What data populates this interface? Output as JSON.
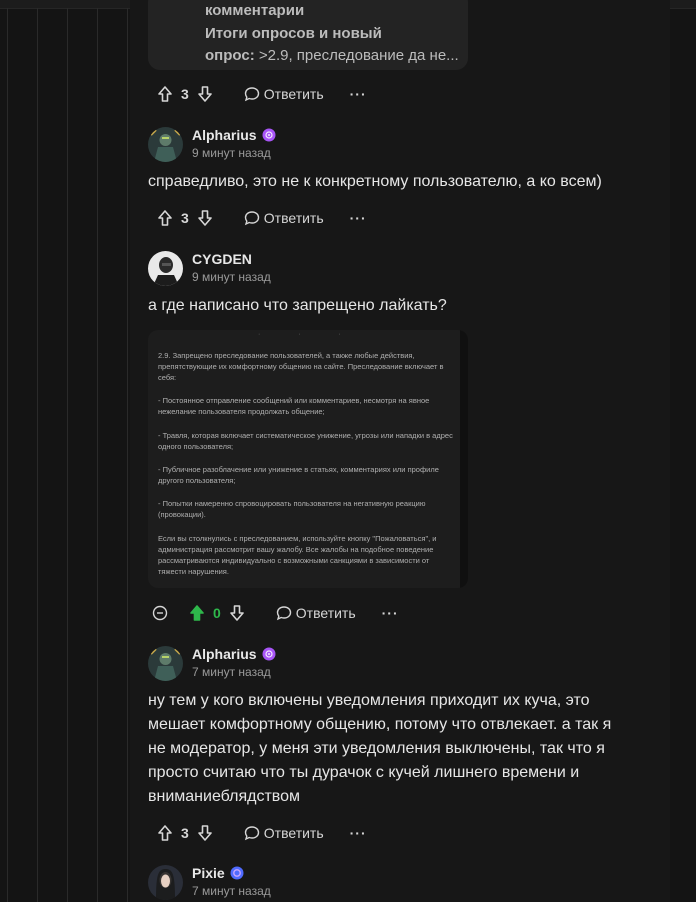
{
  "quote_card": {
    "line1": "комментарии",
    "line2": "Итоги опросов и новый",
    "line3_bold": "опрос:",
    "line3_rest": " >2.9, преследование да не..."
  },
  "comments": [
    {
      "votes": "3",
      "reply_label": "Ответить",
      "more_label": "···"
    },
    {
      "author": "Alpharius",
      "time": "9 минут назад",
      "text": "справедливо, это не к конкретному пользователю, а ко всем)",
      "votes": "3",
      "reply_label": "Ответить",
      "more_label": "···"
    },
    {
      "author": "CYGDEN",
      "time": "9 минут назад",
      "text": "а где написано что запрещено лайкать?",
      "votes": "0",
      "reply_label": "Ответить",
      "more_label": "···"
    },
    {
      "author": "Alpharius",
      "time": "7 минут назад",
      "text_lines": [
        "ну тем у кого включены уведомления приходит их куча, это",
        "мешает комфортному общению, потому что отвлекает. а так я",
        "не модератор, у меня эти уведомления выключены, так что я",
        "просто считаю что ты дурачок с кучей лишнего времени и",
        "вниманиеблядством"
      ],
      "votes": "3",
      "reply_label": "Ответить",
      "more_label": "···"
    },
    {
      "author": "Pixie",
      "time": "7 минут назад"
    }
  ],
  "rules_image": {
    "paragraphs": [
      "2.9. Запрещено преследование пользователей, а также любые действия, препятствующие их комфортному общению на сайте. Преследование включает в себя:",
      "- Постоянное отправление сообщений или комментариев, несмотря на явное нежелание пользователя продолжать общение;",
      "- Травля, которая включает систематическое унижение, угрозы или нападки в адрес одного пользователя;",
      "- Публичное разоблачение или унижение в статьях, комментариях или профиле другого пользователя;",
      "- Попытки намеренно спровоцировать пользователя на негативную реакцию (провокации).",
      "Если вы столкнулись с преследованием, используйте кнопку \"Пожаловаться\", и администрация рассмотрит вашу жалобу. Все жалобы на подобное поведение рассматриваются индивидуально с возможными санкциями в зависимости от тяжести нарушения."
    ]
  },
  "colors": {
    "background": "#141414",
    "upvote_active": "#2eb84b",
    "badge_purple": "#a855f7",
    "badge_blue": "#4f6bff"
  }
}
